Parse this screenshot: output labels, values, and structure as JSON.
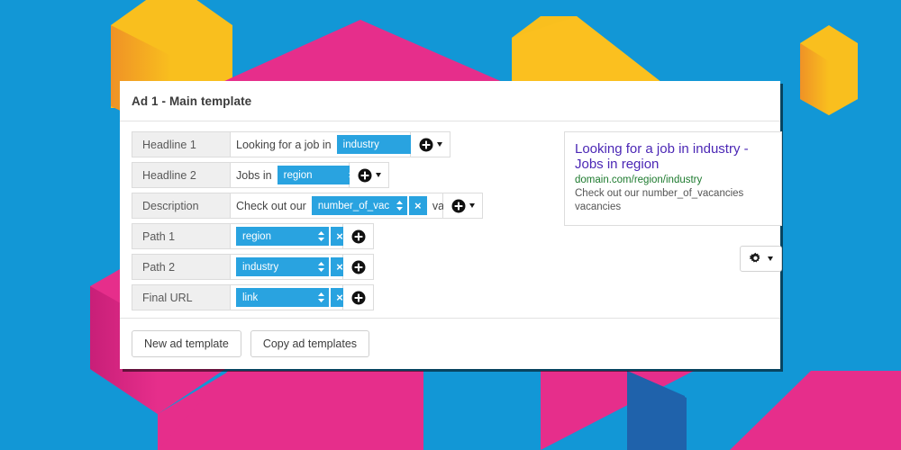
{
  "theme": {
    "background": "#1297d6",
    "accent_blue": "#29a3e0",
    "shape_yellow": "#f9bf1e",
    "shape_pink": "#e62e8b",
    "shape_dark_blue": "#1f5fa9",
    "preview_title": "#4b27b5",
    "preview_url": "#1d7a2e"
  },
  "card": {
    "title": "Ad 1 - Main template",
    "rows": [
      {
        "label": "Headline 1",
        "prefix_text": "Looking for a job in",
        "token": "industry",
        "suffix_text": "",
        "clear_label": "×",
        "field_width": 200,
        "token_width": 92,
        "add_icon": "plus-circle-icon",
        "has_caret": true
      },
      {
        "label": "Headline 2",
        "prefix_text": "Jobs in",
        "token": "region",
        "suffix_text": "",
        "clear_label": "×",
        "field_width": 132,
        "token_width": 80,
        "add_icon": "plus-circle-icon",
        "has_caret": true
      },
      {
        "label": "Description",
        "prefix_text": "Check out our",
        "token": "number_of_vac",
        "suffix_text": "vacancies",
        "clear_label": "×",
        "field_width": 236,
        "token_width": 95,
        "add_icon": "plus-circle-icon",
        "has_caret": true
      },
      {
        "label": "Path 1",
        "prefix_text": "",
        "token": "region",
        "suffix_text": "",
        "clear_label": "×",
        "field_width": 53,
        "token_width": 92,
        "add_icon": "plus-circle-icon",
        "has_caret": false
      },
      {
        "label": "Path 2",
        "prefix_text": "",
        "token": "industry",
        "suffix_text": "",
        "clear_label": "×",
        "field_width": 53,
        "token_width": 92,
        "add_icon": "plus-circle-icon",
        "has_caret": false
      },
      {
        "label": "Final URL",
        "prefix_text": "",
        "token": "link",
        "suffix_text": "",
        "clear_label": "×",
        "field_width": 53,
        "token_width": 92,
        "add_icon": "plus-circle-icon",
        "has_caret": false
      }
    ],
    "footer": {
      "new_template_label": "New ad template",
      "copy_templates_label": "Copy ad templates"
    }
  },
  "preview": {
    "title_line1": "Looking for a job in industry -",
    "title_line2": "Jobs in region",
    "url": "domain.com/region/industry",
    "desc_line1": "Check out our number_of_vacancies",
    "desc_line2": "vacancies",
    "settings_icon": "gear-icon"
  }
}
